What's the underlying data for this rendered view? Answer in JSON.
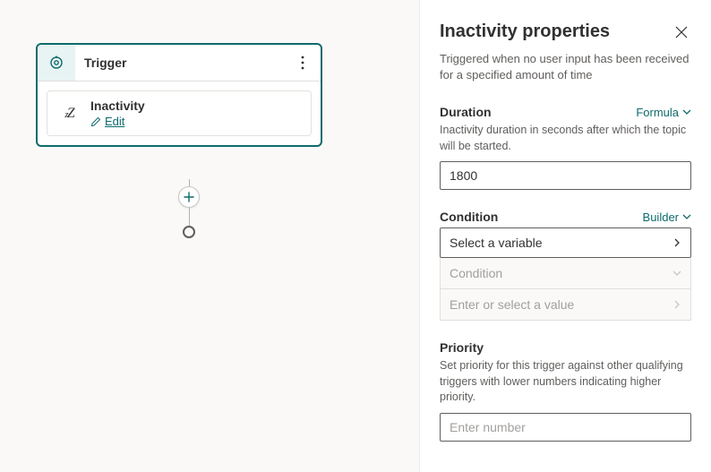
{
  "canvas": {
    "trigger_title": "Trigger",
    "inactivity_label": "Inactivity",
    "edit_label": "Edit"
  },
  "panel": {
    "title": "Inactivity properties",
    "description": "Triggered when no user input has been received for a specified amount of time",
    "duration": {
      "label": "Duration",
      "mode": "Formula",
      "help": "Inactivity duration in seconds after which the topic will be started.",
      "value": "1800"
    },
    "condition": {
      "label": "Condition",
      "mode": "Builder",
      "select_placeholder": "Select a variable",
      "cond_placeholder": "Condition",
      "value_placeholder": "Enter or select a value"
    },
    "priority": {
      "label": "Priority",
      "help": "Set priority for this trigger against other qualifying triggers with lower numbers indicating higher priority.",
      "placeholder": "Enter number"
    }
  }
}
